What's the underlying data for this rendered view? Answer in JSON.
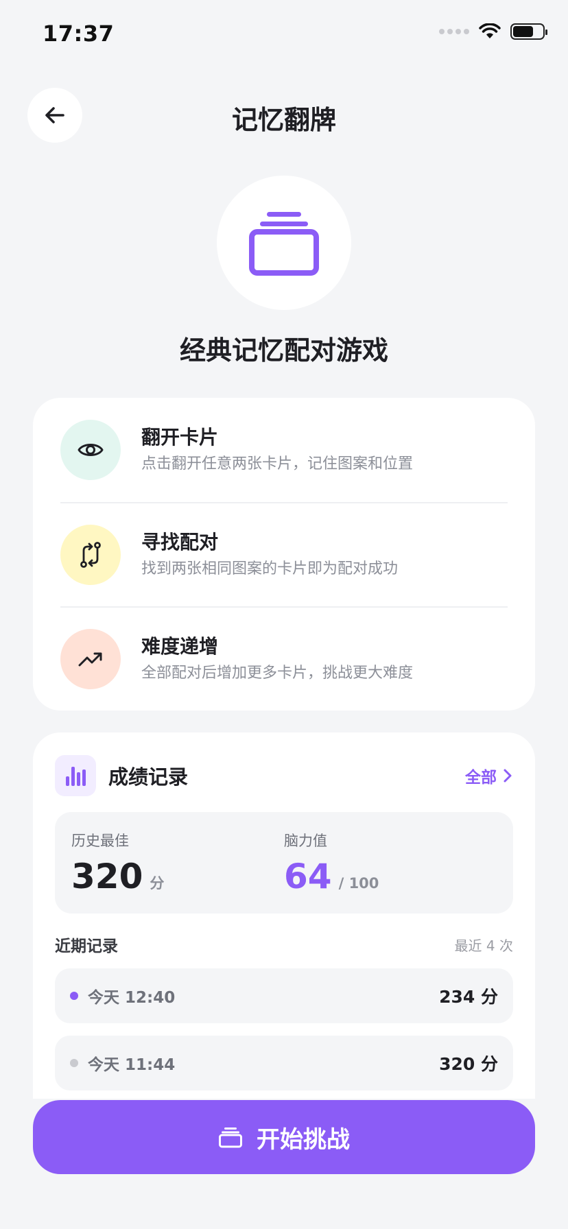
{
  "status_bar": {
    "time": "17:37",
    "battery_level": 0.7
  },
  "header": {
    "title": "记忆翻牌",
    "back_icon": "arrow-left-icon"
  },
  "hero": {
    "icon": "cards-stack-icon",
    "subtitle": "经典记忆配对游戏"
  },
  "rules": [
    {
      "title": "翻开卡片",
      "desc": "点击翻开任意两张卡片，记住图案和位置",
      "icon": "eye-icon",
      "bg": "#E3F6F0"
    },
    {
      "title": "寻找配对",
      "desc": "找到两张相同图案的卡片即为配对成功",
      "icon": "swap-arrows-icon",
      "bg": "#FFF7C2"
    },
    {
      "title": "难度递增",
      "desc": "全部配对后增加更多卡片，挑战更大难度",
      "icon": "trending-up-icon",
      "bg": "#FFE1D6"
    }
  ],
  "scores": {
    "title": "成绩记录",
    "all_label": "全部",
    "best_label": "历史最佳",
    "best_value": "320",
    "best_unit": "分",
    "brain_label": "脑力值",
    "brain_value": "64",
    "brain_unit": "/ 100",
    "recent_title": "近期记录",
    "recent_count": "最近 4 次",
    "records": [
      {
        "time": "今天 12:40",
        "score": "234 分",
        "dot_color": "#8B5CF6"
      },
      {
        "time": "今天 11:44",
        "score": "320 分",
        "dot_color": "#C9CACF"
      }
    ]
  },
  "start_button": {
    "label": "开始挑战",
    "icon": "cards-stack-icon"
  },
  "colors": {
    "accent": "#8B5CF6",
    "background": "#F4F5F7"
  }
}
